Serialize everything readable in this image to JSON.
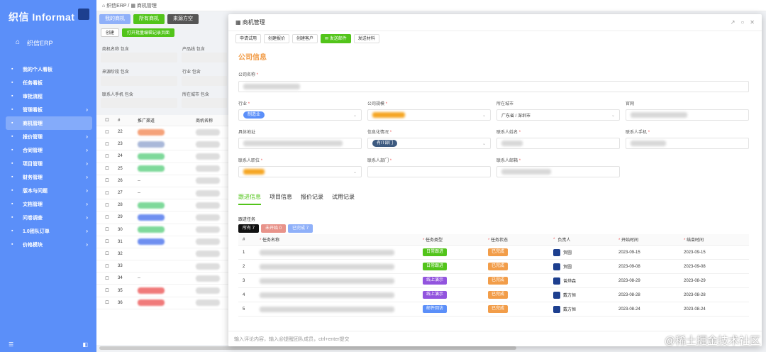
{
  "sidebar": {
    "logo": "织信 Informat",
    "erp_title": "织信ERP",
    "menu": [
      {
        "label": "我的个人看板",
        "icon": "dashboard-icon",
        "arrow": "",
        "active": false
      },
      {
        "label": "任务看板",
        "icon": "task-icon",
        "arrow": "",
        "active": false
      },
      {
        "label": "审批流程",
        "icon": "approval-icon",
        "arrow": "",
        "active": false
      },
      {
        "label": "管理看板",
        "icon": "chart-icon",
        "arrow": "›",
        "active": false
      },
      {
        "label": "商机管理",
        "icon": "opportunity-icon",
        "arrow": "",
        "active": true
      },
      {
        "label": "报价管理",
        "icon": "quote-icon",
        "arrow": "›",
        "active": false
      },
      {
        "label": "合同管理",
        "icon": "contract-icon",
        "arrow": "›",
        "active": false
      },
      {
        "label": "项目管理",
        "icon": "project-icon",
        "arrow": "›",
        "active": false
      },
      {
        "label": "财务管理",
        "icon": "finance-icon",
        "arrow": "›",
        "active": false
      },
      {
        "label": "版本与问题",
        "icon": "version-icon",
        "arrow": "›",
        "active": false
      },
      {
        "label": "文档管理",
        "icon": "doc-icon",
        "arrow": "›",
        "active": false
      },
      {
        "label": "问卷调查",
        "icon": "survey-icon",
        "arrow": "›",
        "active": false
      },
      {
        "label": "1.0团队订单",
        "icon": "order-icon",
        "arrow": "›",
        "active": false
      },
      {
        "label": "价格模块",
        "icon": "price-icon",
        "arrow": "›",
        "active": false
      }
    ]
  },
  "topbar": {
    "home": "织信ERP",
    "sep": "/",
    "page": "商机管理"
  },
  "list_tabs": [
    "我的商机",
    "所有商机",
    "来源方空"
  ],
  "list_buttons": {
    "create": "创建",
    "open_batch": "打开批量编辑记录页面"
  },
  "filters": [
    {
      "label": "商机名称",
      "tag": "包含"
    },
    {
      "label": "产品线",
      "tag": "包含"
    },
    {
      "label": "来源阶段",
      "tag": "包含"
    },
    {
      "label": "行业",
      "tag": "包含"
    },
    {
      "label": "联系人手机",
      "tag": "包含"
    },
    {
      "label": "所在城市",
      "tag": "包含"
    }
  ],
  "grid": {
    "headers": [
      "#",
      "推广渠道",
      "商机名称"
    ],
    "rows": [
      {
        "n": "22",
        "dash": ""
      },
      {
        "n": "23",
        "dash": ""
      },
      {
        "n": "24",
        "dash": "--"
      },
      {
        "n": "25",
        "dash": ""
      },
      {
        "n": "26",
        "dash": "--"
      },
      {
        "n": "27",
        "dash": "--"
      },
      {
        "n": "28",
        "dash": ""
      },
      {
        "n": "29",
        "dash": ""
      },
      {
        "n": "30",
        "dash": ""
      },
      {
        "n": "31",
        "dash": ""
      },
      {
        "n": "32",
        "dash": ""
      },
      {
        "n": "33",
        "dash": ""
      },
      {
        "n": "34",
        "dash": "--"
      },
      {
        "n": "35",
        "dash": ""
      },
      {
        "n": "36",
        "dash": ""
      }
    ]
  },
  "modal": {
    "title": "商机管理",
    "actions": [
      "申请试用",
      "创建报价",
      "创建客户",
      "发送邮件",
      "发送材料"
    ],
    "section": "公司信息",
    "fields": {
      "company": "公司名称",
      "industry": "行业",
      "industry_val": "制造业",
      "scale": "公司规模",
      "city": "所在城市",
      "city_val": "广东省 / 深圳市",
      "website": "官网",
      "address": "具体地址",
      "it": "信息化情况",
      "it_val": "有IT部门",
      "contact_name": "联系人姓名",
      "contact_phone": "联系人手机",
      "position": "联系人职位",
      "department": "联系人部门",
      "email": "联系人邮箱"
    },
    "detail_tabs": [
      "跟进信息",
      "项目信息",
      "报价记录",
      "试用记录"
    ],
    "task_label": "跟进任务",
    "task_filters": [
      "所有 7",
      "未开始 0",
      "已完成 7"
    ],
    "task_headers": [
      "#",
      "任务名称",
      "任务类型",
      "任务状态",
      "负责人",
      "开始时间",
      "结束时间"
    ],
    "tasks": [
      {
        "n": "1",
        "type": "日常跟进",
        "status": "已完成",
        "owner": "贺圆",
        "start": "2023-09-15",
        "end": "2023-09-15"
      },
      {
        "n": "2",
        "type": "日常跟进",
        "status": "已完成",
        "owner": "贺圆",
        "start": "2023-09-08",
        "end": "2023-09-08"
      },
      {
        "n": "3",
        "type": "线上演示",
        "status": "已完成",
        "owner": "曾烨森",
        "start": "2023-08-29",
        "end": "2023-08-29"
      },
      {
        "n": "4",
        "type": "线上演示",
        "status": "已完成",
        "owner": "戴方恒",
        "start": "2023-08-28",
        "end": "2023-08-28"
      },
      {
        "n": "5",
        "type": "邮件回访",
        "status": "已完成",
        "owner": "戴方恒",
        "start": "2023-08-24",
        "end": "2023-08-24"
      }
    ],
    "comment_placeholder": "输入评论内容，输入@提醒团队成员，ctrl+enter提交"
  },
  "watermark": "@稀土掘金技术社区",
  "colors": {
    "sidebar": "#5b8ff9",
    "green": "#52c41a",
    "orange": "#f29d49",
    "tag_blue": "#5b8ff9"
  }
}
